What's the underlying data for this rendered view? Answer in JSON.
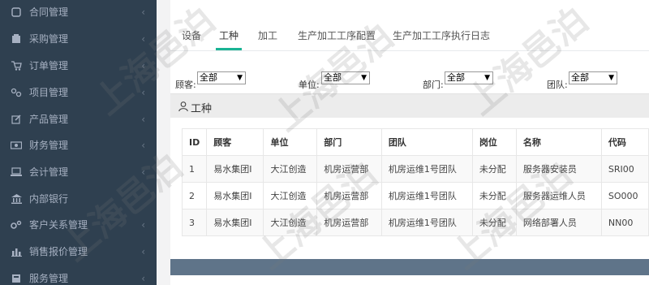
{
  "sidebar": {
    "items": [
      {
        "label": "合同管理",
        "icon": "contract-icon"
      },
      {
        "label": "采购管理",
        "icon": "purchase-icon"
      },
      {
        "label": "订单管理",
        "icon": "cart-icon"
      },
      {
        "label": "项目管理",
        "icon": "project-icon"
      },
      {
        "label": "产品管理",
        "icon": "edit-icon"
      },
      {
        "label": "财务管理",
        "icon": "money-icon"
      },
      {
        "label": "会计管理",
        "icon": "computer-icon"
      },
      {
        "label": "内部银行",
        "icon": "bank-icon"
      },
      {
        "label": "客户关系管理",
        "icon": "gears-icon"
      },
      {
        "label": "销售报价管理",
        "icon": "bar-chart-icon"
      },
      {
        "label": "服务管理",
        "icon": "service-icon"
      }
    ]
  },
  "tabs": [
    "设备",
    "工种",
    "加工",
    "生产加工工序配置",
    "生产加工工序执行日志"
  ],
  "active_tab": "工种",
  "filters": {
    "customer": {
      "label": "顾客:",
      "value": "全部"
    },
    "unit": {
      "label": "单位:",
      "value": "全部"
    },
    "dept": {
      "label": "部门:",
      "value": "全部"
    },
    "team": {
      "label": "团队:",
      "value": "全部"
    }
  },
  "panel": {
    "title": "工种",
    "icon": "user-icon"
  },
  "table": {
    "headers": [
      "ID",
      "顾客",
      "单位",
      "部门",
      "团队",
      "岗位",
      "名称",
      "代码"
    ],
    "rows": [
      [
        "1",
        "易水集团I",
        "大江创造",
        "机房运营部",
        "机房运维1号团队",
        "未分配",
        "服务器安装员",
        "SRI00"
      ],
      [
        "2",
        "易水集团I",
        "大江创造",
        "机房运营部",
        "机房运维1号团队",
        "未分配",
        "服务器运维人员",
        "SO000"
      ],
      [
        "3",
        "易水集团I",
        "大江创造",
        "机房运营部",
        "机房运维1号团队",
        "未分配",
        "网络部署人员",
        "NN00"
      ]
    ]
  },
  "watermark": "上海邑泊",
  "colors": {
    "sidebar": "#2f4050",
    "accent": "#1ab394",
    "footer": "#5f7489"
  }
}
